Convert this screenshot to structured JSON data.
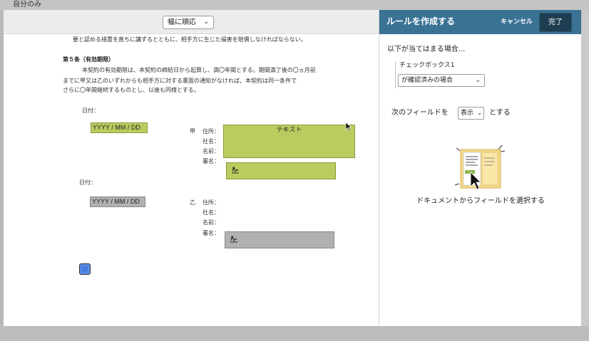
{
  "topbar": {
    "label": "自分のみ"
  },
  "document": {
    "zoom_select": "幅に順応",
    "paragraph_top": "要と認める措置を直ちに講ずるとともに、相手方に生じた損害を賠償しなければならない。",
    "article_heading": "第５条（有効期限）",
    "article_lines": [
      "本契約の有効期限は、本契約の締結日から起算し、満〇年間とする。期間満了後の〇ヵ月前",
      "までに甲又は乙のいずれからも相手方に対する書面の通知がなければ、本契約は同一条件で",
      "さらに〇年間継続するものとし、以後も同様とする。"
    ],
    "date_label_1": "日付：",
    "date_label_2": "日付：",
    "party_a": "甲",
    "party_b": "乙",
    "labels_a": [
      "住所：",
      "社名：",
      "名前：",
      "署名："
    ],
    "labels_b": [
      "住所：",
      "社名：",
      "名前：",
      "署名："
    ],
    "date_field_placeholder_1": "YYYY / MM / DD",
    "date_field_placeholder_2": "YYYY / MM / DD",
    "text_field_label": "テキスト",
    "icons": {
      "signature": "signature-icon",
      "cursor": "mouse-cursor-icon",
      "handle": "field-handle-icon"
    },
    "colors": {
      "field_selected": "#bccb5f",
      "field_unselected": "#b1b1b3"
    }
  },
  "panel": {
    "title": "ルールを作成する",
    "cancel_label": "キャンセル",
    "done_label": "完了",
    "condition_heading": "以下が当てはまる場合...",
    "condition_field": "チェックボックス1",
    "condition_select": "が確認済みの場合",
    "action_prefix": "次のフィールドを",
    "action_select": "表示",
    "action_suffix": "とする",
    "hint": "ドキュメントからフィールドを選択する",
    "header_color": "#3a7294"
  }
}
